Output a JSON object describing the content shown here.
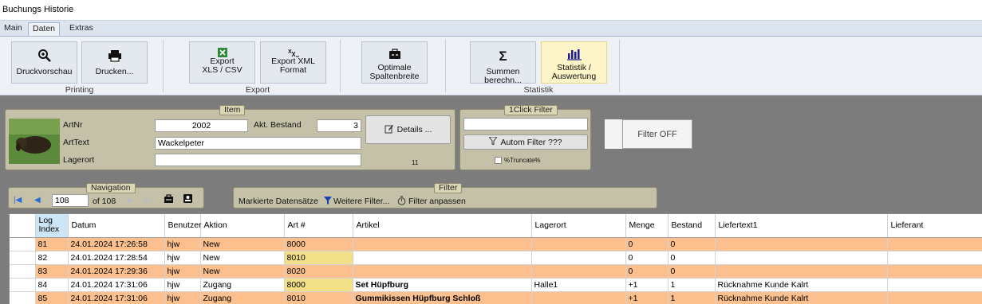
{
  "window": {
    "title": "Buchungs Historie"
  },
  "tabs": [
    {
      "label": "Main"
    },
    {
      "label": "Daten"
    },
    {
      "label": "Extras"
    }
  ],
  "ribbon": {
    "print_preview": "Druckvorschau",
    "print": "Drucken...",
    "group_printing": "Printing",
    "export_xls_1": "Export",
    "export_xls_2": "XLS / CSV",
    "export_xml_1": "Export XML",
    "export_xml_2": "Format",
    "group_export": "Export",
    "optimal_1": "Optimale",
    "optimal_2": "Spaltenbreite",
    "sums": "Summen berechn...",
    "stats_1": "Statistik /",
    "stats_2": "Auswertung",
    "group_stats": "Statistik"
  },
  "item": {
    "title": "Item",
    "artnr_label": "ArtNr",
    "artnr": "2002",
    "bestand_label": "Akt. Bestand",
    "bestand": "3",
    "arttext_label": "ArtText",
    "arttext": "Wackelpeter",
    "lagerort_label": "Lagerort",
    "lagerort": "",
    "details_button": "Details ...",
    "count": "11"
  },
  "oneclick": {
    "title": "1Click Filter",
    "input": "",
    "autom_filter": "Autom Filter ???",
    "truncate_label": "%Truncate%"
  },
  "filter_off": "Filter OFF",
  "navigation": {
    "title": "Navigation",
    "current": "108",
    "of_label": "of 108"
  },
  "filter": {
    "title": "Filter",
    "marked": "Markierte Datensätze",
    "more": "Weitere Filter...",
    "adjust": "Filter anpassen"
  },
  "colors": {
    "orange_row": "#fbc08e",
    "yellow_cell": "#f2e089",
    "panel": "#c4c1a8",
    "ribbon_selected": "#fdf5c8"
  },
  "grid": {
    "columns": [
      "Log Index",
      "Datum",
      "Benutzer",
      "Aktion",
      "Art #",
      "Artikel",
      "Lagerort",
      "Menge",
      "Bestand",
      "Liefertext1",
      "Lieferant"
    ],
    "log_index_line1": "Log",
    "log_index_line2": "Index",
    "rows": [
      {
        "log": "81",
        "datum": "24.01.2024 17:26:58",
        "user": "hjw",
        "aktion": "New",
        "art": "8000",
        "artikel": "",
        "lagerort": "",
        "menge": "0",
        "bestand": "0",
        "liefertext": "",
        "lieferant": ""
      },
      {
        "log": "82",
        "datum": "24.01.2024 17:28:54",
        "user": "hjw",
        "aktion": "New",
        "art": "8010",
        "artikel": "",
        "lagerort": "",
        "menge": "0",
        "bestand": "0",
        "liefertext": "",
        "lieferant": ""
      },
      {
        "log": "83",
        "datum": "24.01.2024 17:29:36",
        "user": "hjw",
        "aktion": "New",
        "art": "8020",
        "artikel": "",
        "lagerort": "",
        "menge": "0",
        "bestand": "0",
        "liefertext": "",
        "lieferant": ""
      },
      {
        "log": "84",
        "datum": "24.01.2024 17:31:06",
        "user": "hjw",
        "aktion": "Zugang",
        "art": "8000",
        "artikel": "Set Hüpfburg",
        "lagerort": "Halle1",
        "menge": "+1",
        "bestand": "1",
        "liefertext": "Rücknahme Kunde Kalrt",
        "lieferant": ""
      },
      {
        "log": "85",
        "datum": "24.01.2024 17:31:06",
        "user": "hjw",
        "aktion": "Zugang",
        "art": "8010",
        "artikel": "Gummikissen Hüpfburg Schloß",
        "lagerort": "",
        "menge": "+1",
        "bestand": "1",
        "liefertext": "Rücknahme Kunde Kalrt",
        "lieferant": ""
      }
    ]
  }
}
